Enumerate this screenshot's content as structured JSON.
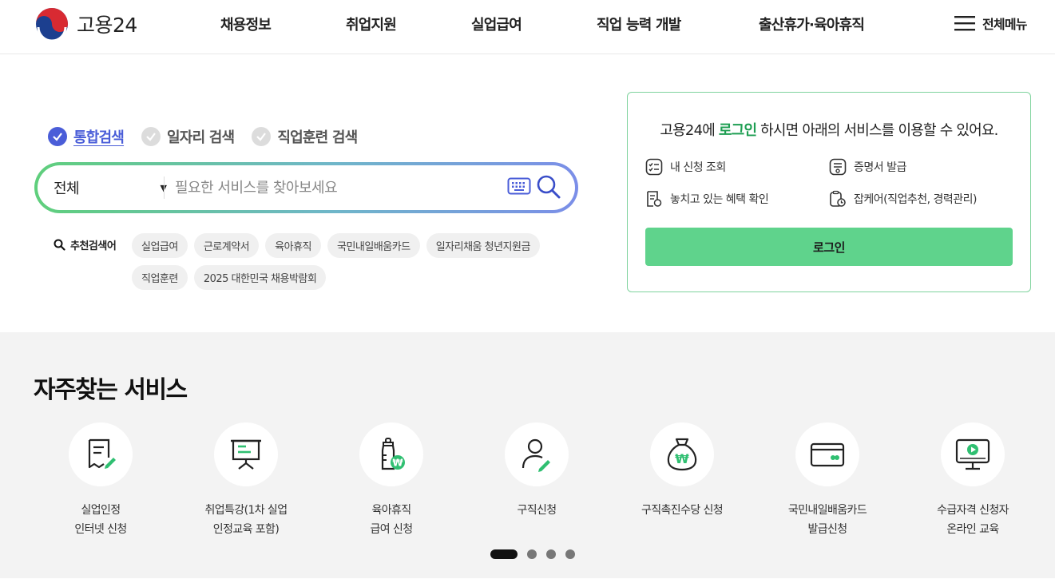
{
  "header": {
    "logo_text": "고용24",
    "nav": [
      {
        "label": "채용정보"
      },
      {
        "label": "취업지원"
      },
      {
        "label": "실업급여"
      },
      {
        "label": "직업 능력 개발"
      },
      {
        "label": "출산휴가·육아휴직"
      }
    ],
    "all_menu_label": "전체메뉴"
  },
  "search": {
    "tabs": [
      {
        "label": "통합검색",
        "active": true
      },
      {
        "label": "일자리 검색",
        "active": false
      },
      {
        "label": "직업훈련 검색",
        "active": false
      }
    ],
    "scope_value": "전체",
    "placeholder": "필요한 서비스를 찾아보세요",
    "recommended_label": "추천검색어",
    "recommended": [
      "실업급여",
      "근로계약서",
      "육아휴직",
      "국민내일배움카드",
      "일자리채움 청년지원금",
      "직업훈련",
      "2025 대한민국 채용박람회"
    ]
  },
  "login_box": {
    "msg_prefix": "고용24에 ",
    "msg_highlight": "로그인",
    "msg_suffix": " 하시면 아래의 서비스를 이용할 수 있어요.",
    "services": [
      {
        "label": "내 신청 조회",
        "icon": "checklist-icon"
      },
      {
        "label": "증명서 발급",
        "icon": "certificate-icon"
      },
      {
        "label": "놓치고 있는 혜택 확인",
        "icon": "benefit-document-icon"
      },
      {
        "label": "잡케어(직업추천, 경력관리)",
        "icon": "clipboard-clock-icon"
      }
    ],
    "login_button": "로그인"
  },
  "frequent": {
    "title": "자주찾는 서비스",
    "items": [
      {
        "line1": "실업인정",
        "line2": "인터넷 신청",
        "icon": "document-pen-icon"
      },
      {
        "line1": "취업특강(1차 실업",
        "line2": "인정교육 포함)",
        "icon": "presentation-board-icon"
      },
      {
        "line1": "육아휴직",
        "line2": "급여 신청",
        "icon": "baby-bottle-won-icon"
      },
      {
        "line1": "구직신청",
        "line2": "",
        "icon": "person-pen-icon"
      },
      {
        "line1": "구직촉진수당 신청",
        "line2": "",
        "icon": "money-bag-won-icon"
      },
      {
        "line1": "국민내일배움카드",
        "line2": "발급신청",
        "icon": "card-icon"
      },
      {
        "line1": "수급자격 신청자",
        "line2": "온라인 교육",
        "icon": "monitor-play-icon"
      }
    ],
    "pager": {
      "total": 4,
      "current": 1
    }
  },
  "colors": {
    "accent_blue": "#4a5dd8",
    "accent_green": "#1e9e52",
    "login_button": "#5fd38c",
    "icon_green": "#2fbf71"
  }
}
